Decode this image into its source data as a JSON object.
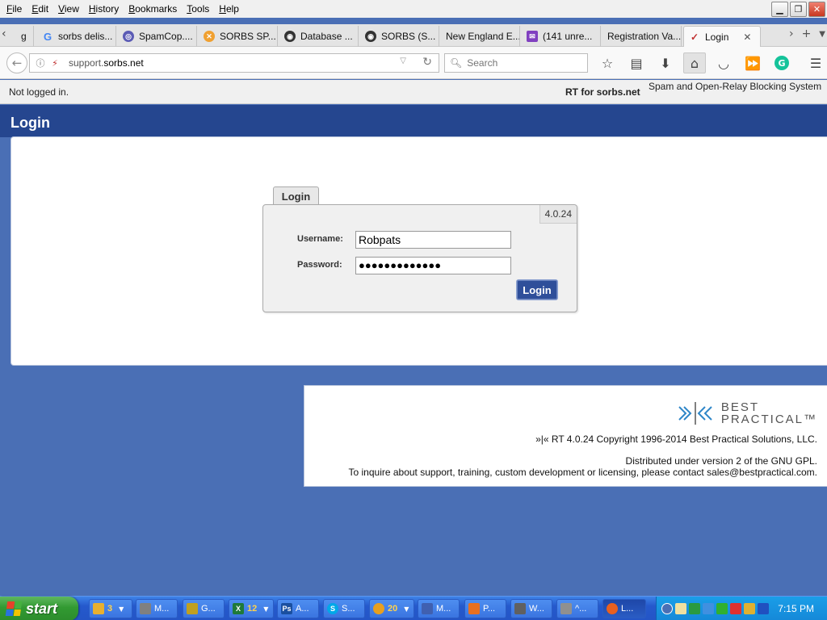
{
  "menu": {
    "items": [
      {
        "u": "F",
        "rest": "ile"
      },
      {
        "u": "E",
        "rest": "dit"
      },
      {
        "u": "V",
        "rest": "iew"
      },
      {
        "u": "H",
        "rest": "istory"
      },
      {
        "u": "B",
        "rest": "ookmarks"
      },
      {
        "u": "T",
        "rest": "ools"
      },
      {
        "u": "H",
        "rest": "elp"
      }
    ]
  },
  "tabs": [
    {
      "label": "g",
      "icon": "",
      "icon_color": "#ffffff"
    },
    {
      "label": "sorbs delis...",
      "icon": "G",
      "icon_color": "#4285f4"
    },
    {
      "label": "SpamCop....",
      "icon": "◎",
      "icon_color": "#5b5bb5"
    },
    {
      "label": "SORBS SP...",
      "icon": "✕",
      "icon_color": "#f0a030"
    },
    {
      "label": "Database ...",
      "icon": "◉",
      "icon_color": "#333333"
    },
    {
      "label": "SORBS (S...",
      "icon": "◉",
      "icon_color": "#333333"
    },
    {
      "label": "New England E...",
      "icon": "",
      "icon_color": "#ffffff"
    },
    {
      "label": "(141 unre...",
      "icon": "✉",
      "icon_color": "#8040c0"
    },
    {
      "label": "Registration Va...",
      "icon": "",
      "icon_color": "#ffffff"
    },
    {
      "label": "Login",
      "icon": "✓",
      "icon_color": "#c03030"
    }
  ],
  "navbar": {
    "url_host": "support.",
    "url_domain": "sorbs.net",
    "search_placeholder": "Search"
  },
  "rt_header": {
    "status": "Not logged in.",
    "rt_for": "RT for sorbs.net",
    "tagline": "Spam and Open-Relay Blocking System"
  },
  "page": {
    "title": "Login"
  },
  "login": {
    "tab_label": "Login",
    "version": "4.0.24",
    "username_label": "Username:",
    "username_value": "Robpats",
    "password_label": "Password:",
    "password_value": "●●●●●●●●●●●●●",
    "button_label": "Login"
  },
  "footer": {
    "logo_line1": "BEST",
    "logo_line2": "PRACTICAL™",
    "copyright": "»|« RT 4.0.24 Copyright 1996-2014 Best Practical Solutions, LLC.",
    "license": "Distributed under version 2 of the GNU GPL.",
    "contact": "To inquire about support, training, custom development or licensing, please contact sales@bestpractical.com."
  },
  "taskbar": {
    "start_label": "start",
    "tasks": [
      {
        "count": "3",
        "label": "",
        "icon_color": "#e8b030",
        "arrow": true
      },
      {
        "count": "",
        "label": "M...",
        "icon_color": "#808080",
        "arrow": false
      },
      {
        "count": "",
        "label": "G...",
        "icon_color": "#c0a020",
        "arrow": false
      },
      {
        "count": "12",
        "label": "",
        "icon_color": "#1f7a3a",
        "arrow": true
      },
      {
        "count": "",
        "label": "A...",
        "icon_color": "#1a4fa0",
        "arrow": false
      },
      {
        "count": "",
        "label": "S...",
        "icon_color": "#00a8e8",
        "arrow": false
      },
      {
        "count": "20",
        "label": "",
        "icon_color": "#e8a020",
        "arrow": true
      },
      {
        "count": "",
        "label": "M...",
        "icon_color": "#4060b0",
        "arrow": false
      },
      {
        "count": "",
        "label": "P...",
        "icon_color": "#e87020",
        "arrow": false
      },
      {
        "count": "",
        "label": "W...",
        "icon_color": "#606060",
        "arrow": false
      },
      {
        "count": "",
        "label": "^...",
        "icon_color": "#909090",
        "arrow": false
      },
      {
        "count": "",
        "label": "L...",
        "icon_color": "#e86020",
        "arrow": false
      }
    ],
    "clock": "7:15 PM"
  }
}
